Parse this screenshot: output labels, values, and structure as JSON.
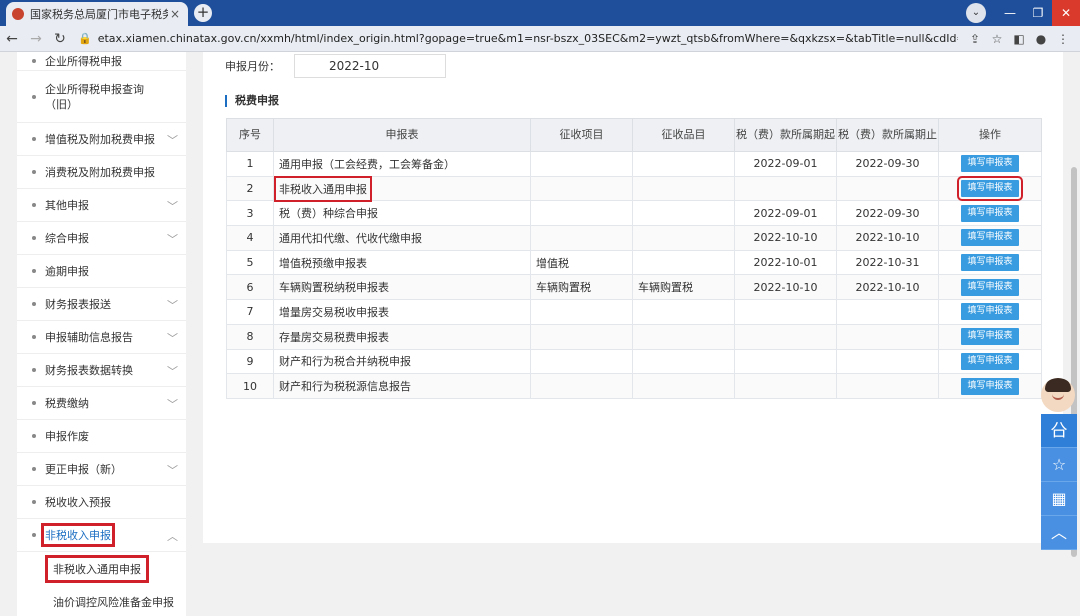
{
  "browser": {
    "tab_title": "国家税务总局厦门市电子税务局",
    "tab_close": "×",
    "new_tab": "+",
    "url": "etax.xiamen.chinatax.gov.cn/xxmh/html/index_origin.html?gopage=true&m1=nsr-bszx_03SEC&m2=ywzt_qtsb&fromWhere=&qxkzsx=&tabTitle=null&cdId=null&gn..."
  },
  "sidebar": {
    "items": [
      {
        "label": "企业所得税申报",
        "chevron": false
      },
      {
        "label": "企业所得税申报查询（旧）",
        "chevron": false
      },
      {
        "label": "增值税及附加税费申报",
        "chevron": true
      },
      {
        "label": "消费税及附加税费申报",
        "chevron": false
      },
      {
        "label": "其他申报",
        "chevron": true
      },
      {
        "label": "综合申报",
        "chevron": true
      },
      {
        "label": "逾期申报",
        "chevron": false
      },
      {
        "label": "财务报表报送",
        "chevron": true
      },
      {
        "label": "申报辅助信息报告",
        "chevron": true
      },
      {
        "label": "财务报表数据转换",
        "chevron": true
      },
      {
        "label": "税费缴纳",
        "chevron": true
      },
      {
        "label": "申报作废",
        "chevron": false
      },
      {
        "label": "更正申报（新）",
        "chevron": true
      },
      {
        "label": "税收收入预报",
        "chevron": false
      },
      {
        "label": "非税收入申报",
        "chevron": true
      }
    ],
    "sub_items": [
      "非税收入通用申报",
      "油价调控风险准备金申报"
    ]
  },
  "main": {
    "month_label": "申报月份：",
    "month_value": "2022-10",
    "section_title": "税费申报",
    "columns": [
      "序号",
      "申报表",
      "征收项目",
      "征收品目",
      "税（费）款所属期起",
      "税（费）款所属期止",
      "操作"
    ],
    "action_label": "填写申报表",
    "rows": [
      {
        "no": "1",
        "form": "通用申报（工会经费，工会筹备金）",
        "item": "",
        "sub_item": "",
        "start": "2022-09-01",
        "end": "2022-09-30"
      },
      {
        "no": "2",
        "form": "非税收入通用申报",
        "item": "",
        "sub_item": "",
        "start": "",
        "end": ""
      },
      {
        "no": "3",
        "form": "税（费）种综合申报",
        "item": "",
        "sub_item": "",
        "start": "2022-09-01",
        "end": "2022-09-30"
      },
      {
        "no": "4",
        "form": "通用代扣代缴、代收代缴申报",
        "item": "",
        "sub_item": "",
        "start": "2022-10-10",
        "end": "2022-10-10"
      },
      {
        "no": "5",
        "form": "增值税预缴申报表",
        "item": "增值税",
        "sub_item": "",
        "start": "2022-10-01",
        "end": "2022-10-31"
      },
      {
        "no": "6",
        "form": "车辆购置税纳税申报表",
        "item": "车辆购置税",
        "sub_item": "车辆购置税",
        "start": "2022-10-10",
        "end": "2022-10-10"
      },
      {
        "no": "7",
        "form": "增量房交易税收申报表",
        "item": "",
        "sub_item": "",
        "start": "",
        "end": ""
      },
      {
        "no": "8",
        "form": "存量房交易税费申报表",
        "item": "",
        "sub_item": "",
        "start": "",
        "end": ""
      },
      {
        "no": "9",
        "form": "财产和行为税合并纳税申报",
        "item": "",
        "sub_item": "",
        "start": "",
        "end": ""
      },
      {
        "no": "10",
        "form": "财产和行为税税源信息报告",
        "item": "",
        "sub_item": "",
        "start": "",
        "end": ""
      }
    ]
  },
  "float_tools": {
    "items": [
      {
        "name": "service-icon",
        "glyph": "㕣"
      },
      {
        "name": "star-icon",
        "glyph": "☆"
      },
      {
        "name": "calculator-icon",
        "glyph": "▦"
      },
      {
        "name": "up-icon",
        "glyph": "︿"
      }
    ]
  },
  "colors": {
    "accent": "#1b6ec2",
    "button": "#3a9ce0",
    "highlight": "#d0202a",
    "tab_bar": "#1f4f9a"
  }
}
